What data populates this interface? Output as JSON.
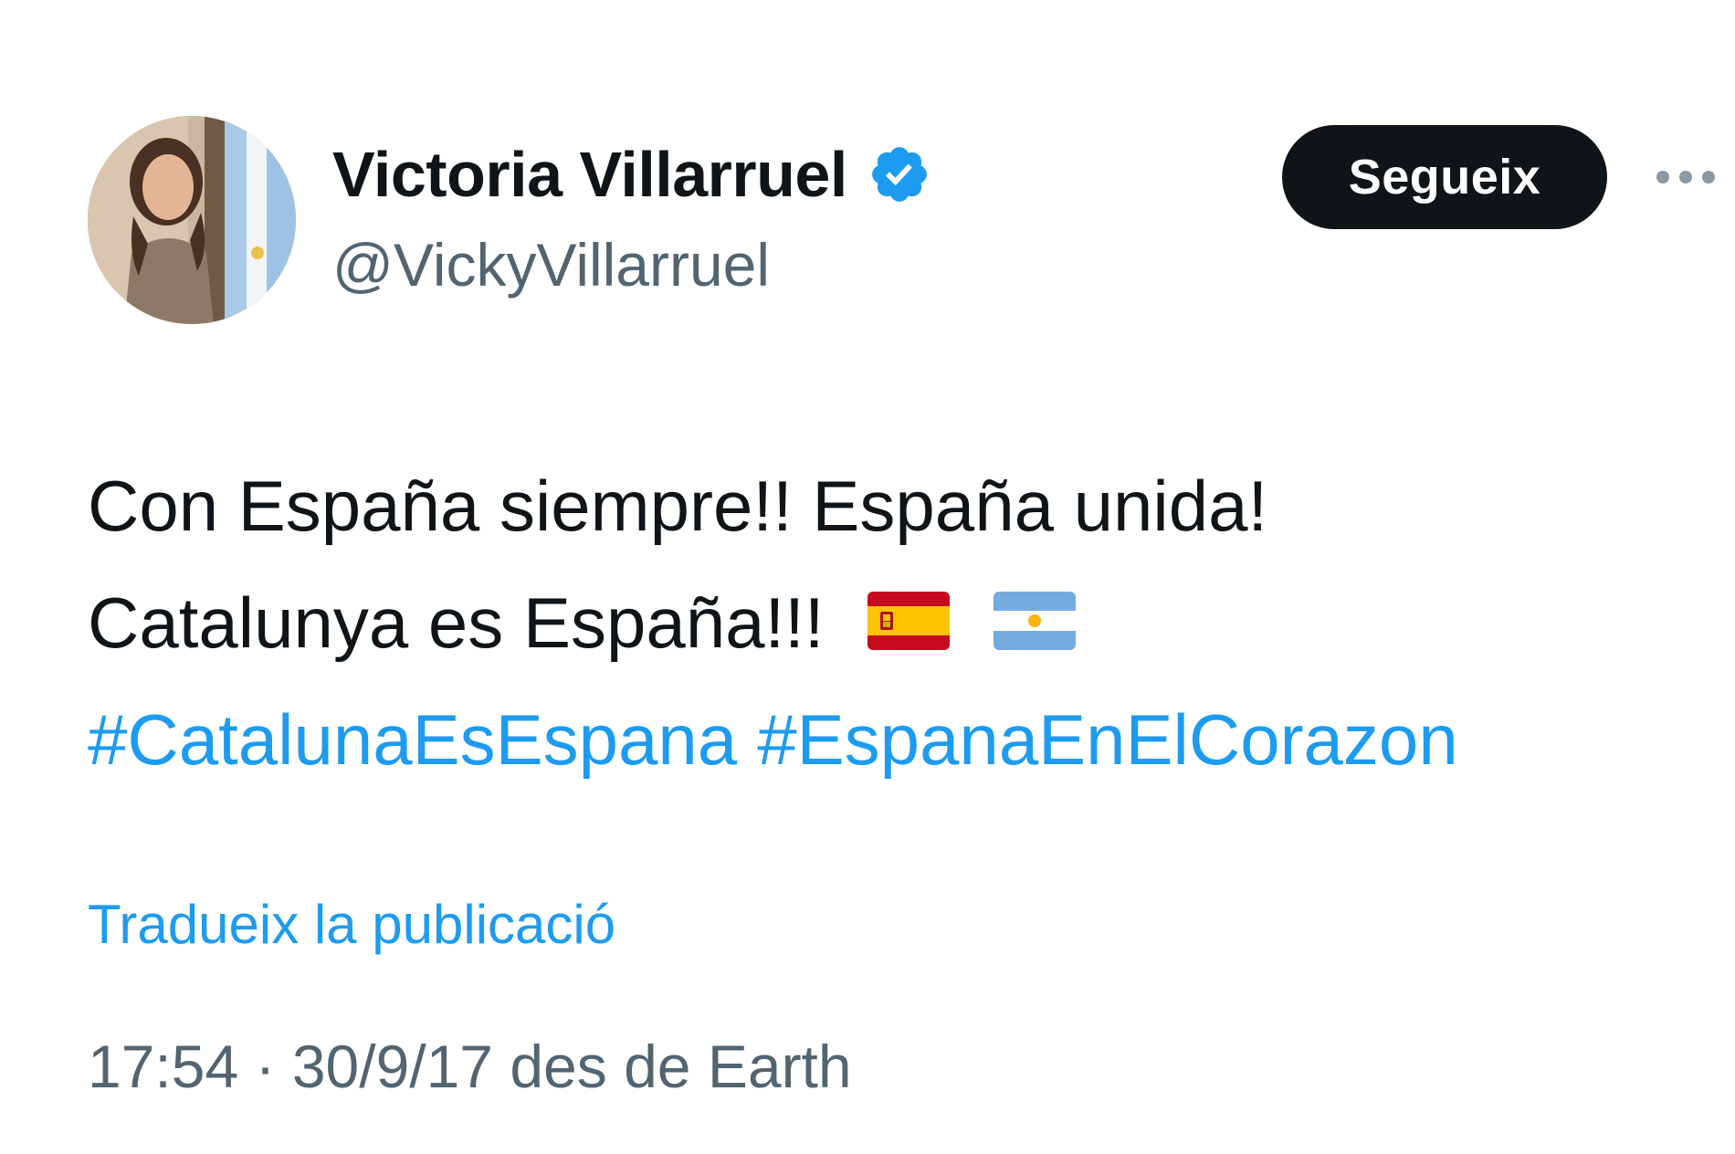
{
  "author": {
    "display_name": "Victoria Villarruel",
    "handle": "@VickyVillarruel",
    "verified_icon": "verified-badge-icon",
    "avatar": "profile-photo"
  },
  "actions": {
    "follow_label": "Segueix",
    "more_icon": "more-options-icon"
  },
  "tweet": {
    "line1": "Con España siempre!! España unida!",
    "line2": "Catalunya es España!!!",
    "flags": [
      "spain-flag-icon",
      "argentina-flag-icon"
    ],
    "hashtags": [
      "#CatalunaEsEspana",
      "#EspanaEnElCorazon"
    ]
  },
  "translate_label": "Tradueix la publicació",
  "meta": {
    "text": "17:54 · 30/9/17 des de Earth"
  },
  "colors": {
    "link": "#1d9bf0",
    "secondary_text": "#536471",
    "primary_text": "#0f1419",
    "follow_button_bg": "#0f1419"
  }
}
